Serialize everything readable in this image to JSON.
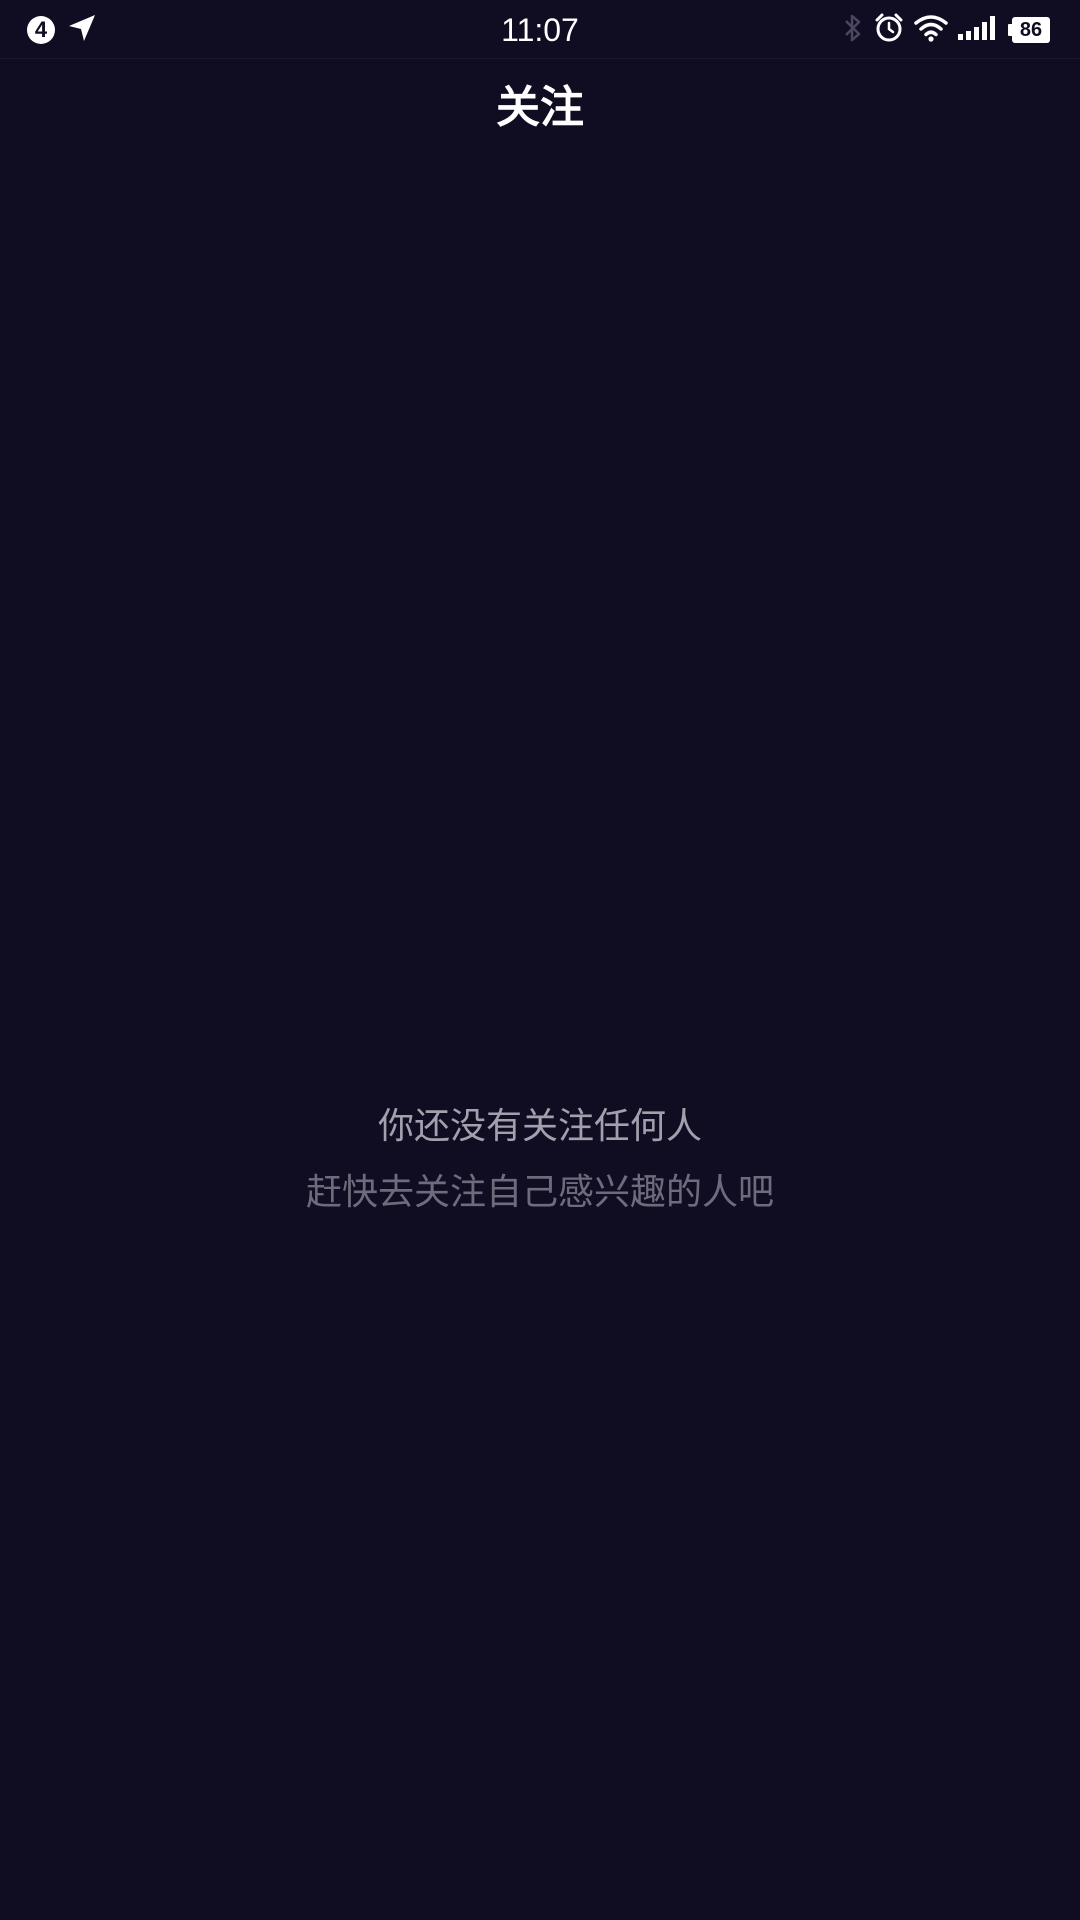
{
  "status_bar": {
    "notification_count": "4",
    "time": "11:07",
    "battery_level": "86",
    "icons": [
      "notification-count-icon",
      "location-arrow-icon",
      "bluetooth-icon",
      "alarm-icon",
      "wifi-icon",
      "signal-icon",
      "battery-icon"
    ]
  },
  "header": {
    "title": "关注"
  },
  "empty_state": {
    "title": "你还没有关注任何人",
    "subtitle": "赶快去关注自己感兴趣的人吧"
  },
  "colors": {
    "background": "#100c22",
    "title_text": "#ffffff",
    "empty_title_text": "#a3a0ad",
    "empty_subtitle_text": "#6f6b7c"
  }
}
